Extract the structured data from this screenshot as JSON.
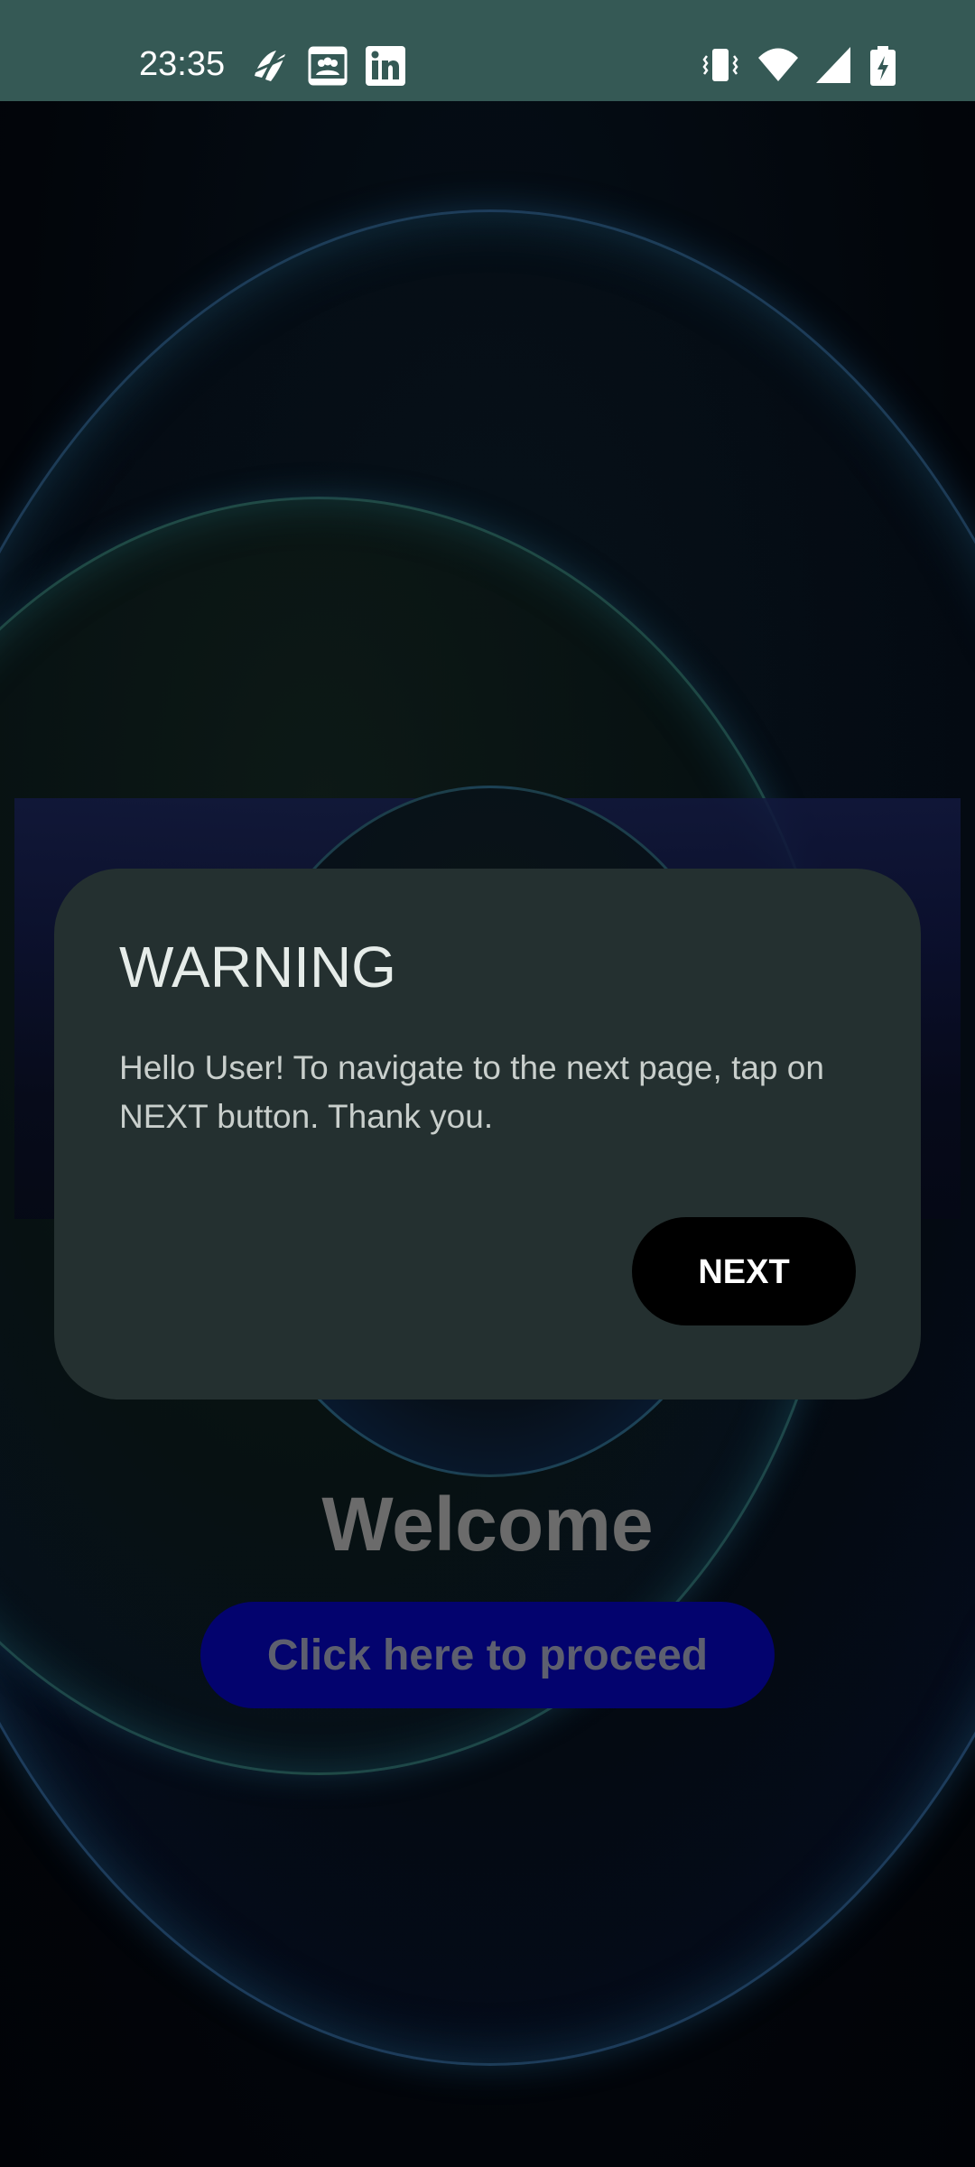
{
  "status_bar": {
    "time": "23:35",
    "notification_icons": [
      "swirl-app-icon",
      "contacts-card-icon",
      "linkedin-icon"
    ],
    "system_icons": [
      "vibrate-icon",
      "wifi-icon",
      "cellular-signal-icon",
      "battery-charging-icon"
    ]
  },
  "background": {
    "welcome_text": "Welcome",
    "proceed_button_label": "Click here to proceed"
  },
  "dialog": {
    "title": "WARNING",
    "message": "Hello User! To navigate to the next page, tap on NEXT button. Thank you.",
    "next_button_label": "NEXT"
  },
  "colors": {
    "status_bar": "#355955",
    "dialog_bg": "#243030",
    "next_button_bg": "#000000",
    "proceed_button_bg": "#03036e",
    "welcome_text": "#6b6b6b"
  }
}
